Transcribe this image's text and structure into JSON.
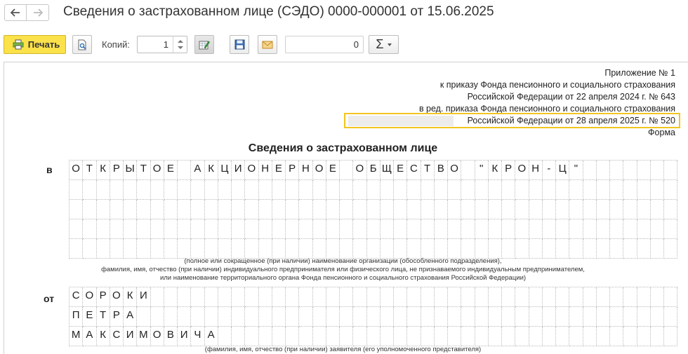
{
  "window": {
    "title": "Сведения о застрахованном лице (СЭДО) 0000-000001 от 15.06.2025"
  },
  "toolbar": {
    "print_label": "Печать",
    "copies_label": "Копий:",
    "copies_value": "1",
    "sum_value": "0",
    "sigma_label": "Σ"
  },
  "document": {
    "header_lines": [
      "Приложение № 1",
      "к приказу Фонда пенсионного и социального страхования",
      "Российской Федерации от 22 апреля 2024 г. № 643",
      "в ред. приказа Фонда пенсионного и социального страхования",
      "Российской Федерации от 28 апреля 2025 г. № 520",
      "Форма"
    ],
    "title": "Сведения о застрахованном лице",
    "to_label": "в",
    "to_rows": [
      "ОТКРЫТОЕ АКЦИОНЕРНОЕ ОБЩЕСТВО \"КРОН-Ц\"",
      "",
      "",
      "",
      ""
    ],
    "to_caption": [
      "(полное или сокращенное (при наличии) наименование организации (обособленного подразделения),",
      "фамилия, имя, отчество (при наличии) индивидуального предпринимателя или физического лица, не признаваемого индивидуальным предпринимателем,",
      "или наименование территориального органа Фонда пенсионного и социального страхования Российской Федерации)"
    ],
    "from_label": "от",
    "from_rows": [
      "СОРОКИ",
      "ПЕТРА",
      "МАКСИМОВИЧА"
    ],
    "from_caption": "(фамилия, имя, отчество (при наличии) заявителя (его уполномоченного представителя)"
  }
}
